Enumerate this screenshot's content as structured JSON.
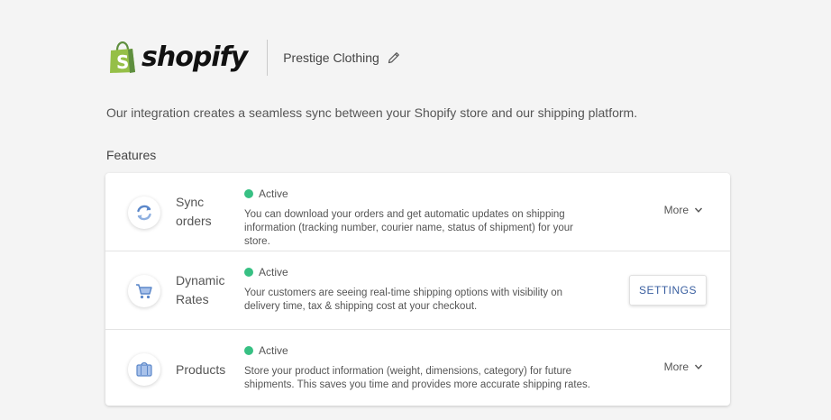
{
  "header": {
    "logo_text": "shopify",
    "store_name": "Prestige Clothing"
  },
  "intro": "Our integration creates a seamless sync between your Shopify store and our shipping platform.",
  "features_heading": "Features",
  "colors": {
    "status_active": "#37c083",
    "brand_green": "#95bf47",
    "settings_text": "#3a5fa0"
  },
  "features": [
    {
      "title": "Sync orders",
      "icon": "sync-icon",
      "status": "Active",
      "description": "You can download your orders and get automatic updates on shipping information (tracking number, courier name, status of shipment) for your store.",
      "action": "More"
    },
    {
      "title": "Dynamic Rates",
      "icon": "cart-icon",
      "status": "Active",
      "description": "Your customers are seeing real-time shipping options with visibility on delivery time, tax & shipping cost at your checkout.",
      "action": "SETTINGS"
    },
    {
      "title": "Products",
      "icon": "box-icon",
      "status": "Active",
      "description": "Store your product information (weight, dimensions, category) for future shipments. This saves you time and provides more accurate shipping rates.",
      "action": "More"
    }
  ]
}
